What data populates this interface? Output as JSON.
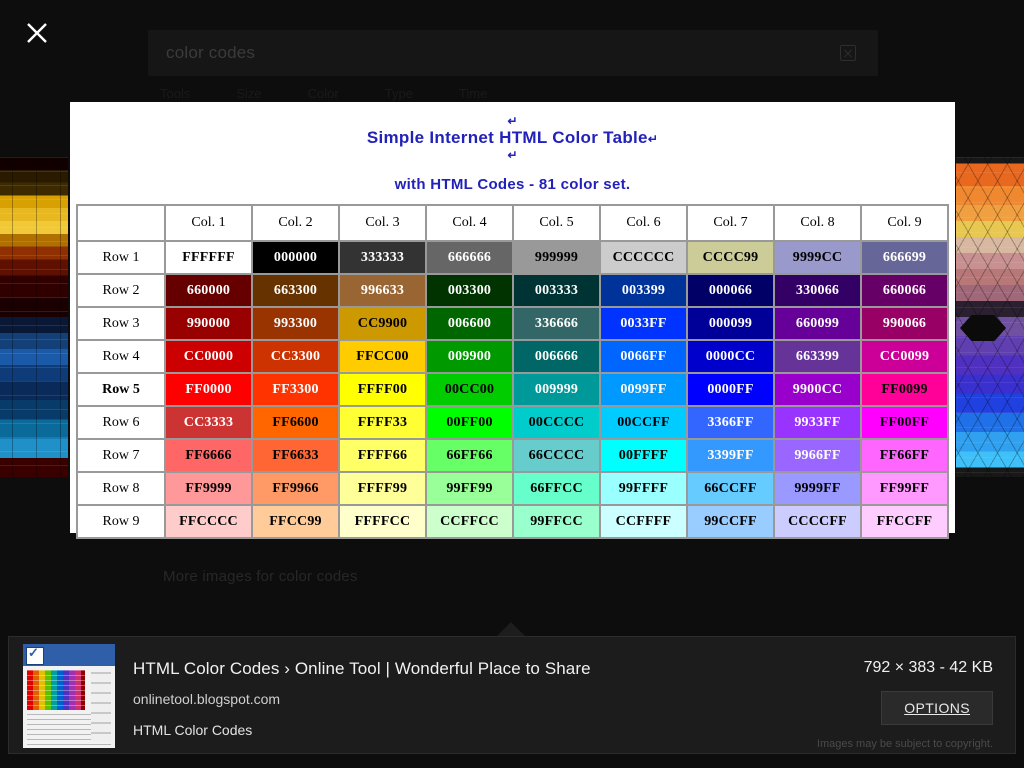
{
  "overlay": {
    "close_icon": "close-icon"
  },
  "search": {
    "query": "color codes",
    "clear_icon": "clear-icon",
    "filters": [
      "Tools",
      "Size",
      "Color",
      "Type",
      "Time"
    ]
  },
  "results": {
    "more_images_label": "More images for color codes"
  },
  "image": {
    "title_line1": "Simple Internet HTML Color Table",
    "title_line2": "with HTML Codes - 81 color set.",
    "pilcrow": "↵",
    "title_color": "#2222BB",
    "background": "#FFFFFF",
    "border_color": "#999999",
    "table": {
      "corner_label": "",
      "column_headers": [
        "Col. 1",
        "Col. 2",
        "Col. 3",
        "Col. 4",
        "Col. 5",
        "Col. 6",
        "Col. 7",
        "Col. 8",
        "Col. 9"
      ],
      "rows": [
        {
          "label": "Row 1",
          "bold_label": false,
          "cells": [
            {
              "hex": "FFFFFF",
              "bg": "#FFFFFF",
              "fg": "#000000"
            },
            {
              "hex": "000000",
              "bg": "#000000",
              "fg": "#FFFFFF"
            },
            {
              "hex": "333333",
              "bg": "#333333",
              "fg": "#FFFFFF"
            },
            {
              "hex": "666666",
              "bg": "#666666",
              "fg": "#FFFFFF"
            },
            {
              "hex": "999999",
              "bg": "#999999",
              "fg": "#000000"
            },
            {
              "hex": "CCCCCC",
              "bg": "#CCCCCC",
              "fg": "#000000"
            },
            {
              "hex": "CCCC99",
              "bg": "#CCCC99",
              "fg": "#000000"
            },
            {
              "hex": "9999CC",
              "bg": "#9999CC",
              "fg": "#000000"
            },
            {
              "hex": "666699",
              "bg": "#666699",
              "fg": "#FFFFFF"
            }
          ]
        },
        {
          "label": "Row 2",
          "bold_label": false,
          "cells": [
            {
              "hex": "660000",
              "bg": "#660000",
              "fg": "#FFFFFF"
            },
            {
              "hex": "663300",
              "bg": "#663300",
              "fg": "#FFFFFF"
            },
            {
              "hex": "996633",
              "bg": "#996633",
              "fg": "#FFFFFF"
            },
            {
              "hex": "003300",
              "bg": "#003300",
              "fg": "#FFFFFF"
            },
            {
              "hex": "003333",
              "bg": "#003333",
              "fg": "#FFFFFF"
            },
            {
              "hex": "003399",
              "bg": "#003399",
              "fg": "#FFFFFF"
            },
            {
              "hex": "000066",
              "bg": "#000066",
              "fg": "#FFFFFF"
            },
            {
              "hex": "330066",
              "bg": "#330066",
              "fg": "#FFFFFF"
            },
            {
              "hex": "660066",
              "bg": "#660066",
              "fg": "#FFFFFF"
            }
          ]
        },
        {
          "label": "Row 3",
          "bold_label": false,
          "cells": [
            {
              "hex": "990000",
              "bg": "#990000",
              "fg": "#FFFFFF"
            },
            {
              "hex": "993300",
              "bg": "#993300",
              "fg": "#FFFFFF"
            },
            {
              "hex": "CC9900",
              "bg": "#CC9900",
              "fg": "#000000"
            },
            {
              "hex": "006600",
              "bg": "#006600",
              "fg": "#FFFFFF"
            },
            {
              "hex": "336666",
              "bg": "#336666",
              "fg": "#FFFFFF"
            },
            {
              "hex": "0033FF",
              "bg": "#0033FF",
              "fg": "#FFFFFF"
            },
            {
              "hex": "000099",
              "bg": "#000099",
              "fg": "#FFFFFF"
            },
            {
              "hex": "660099",
              "bg": "#660099",
              "fg": "#FFFFFF"
            },
            {
              "hex": "990066",
              "bg": "#990066",
              "fg": "#FFFFFF"
            }
          ]
        },
        {
          "label": "Row 4",
          "bold_label": false,
          "cells": [
            {
              "hex": "CC0000",
              "bg": "#CC0000",
              "fg": "#FFFFFF"
            },
            {
              "hex": "CC3300",
              "bg": "#CC3300",
              "fg": "#FFFFFF"
            },
            {
              "hex": "FFCC00",
              "bg": "#FFCC00",
              "fg": "#000000"
            },
            {
              "hex": "009900",
              "bg": "#009900",
              "fg": "#FFFFFF"
            },
            {
              "hex": "006666",
              "bg": "#006666",
              "fg": "#FFFFFF"
            },
            {
              "hex": "0066FF",
              "bg": "#0066FF",
              "fg": "#FFFFFF"
            },
            {
              "hex": "0000CC",
              "bg": "#0000CC",
              "fg": "#FFFFFF"
            },
            {
              "hex": "663399",
              "bg": "#663399",
              "fg": "#FFFFFF"
            },
            {
              "hex": "CC0099",
              "bg": "#CC0099",
              "fg": "#FFFFFF"
            }
          ]
        },
        {
          "label": "Row 5",
          "bold_label": true,
          "cells": [
            {
              "hex": "FF0000",
              "bg": "#FF0000",
              "fg": "#FFFFFF"
            },
            {
              "hex": "FF3300",
              "bg": "#FF3300",
              "fg": "#FFFFFF"
            },
            {
              "hex": "FFFF00",
              "bg": "#FFFF00",
              "fg": "#000000"
            },
            {
              "hex": "00CC00",
              "bg": "#00CC00",
              "fg": "#000000"
            },
            {
              "hex": "009999",
              "bg": "#009999",
              "fg": "#FFFFFF"
            },
            {
              "hex": "0099FF",
              "bg": "#0099FF",
              "fg": "#FFFFFF"
            },
            {
              "hex": "0000FF",
              "bg": "#0000FF",
              "fg": "#FFFFFF"
            },
            {
              "hex": "9900CC",
              "bg": "#9900CC",
              "fg": "#FFFFFF"
            },
            {
              "hex": "FF0099",
              "bg": "#FF0099",
              "fg": "#000000"
            }
          ]
        },
        {
          "label": "Row 6",
          "bold_label": false,
          "cells": [
            {
              "hex": "CC3333",
              "bg": "#CC3333",
              "fg": "#FFFFFF"
            },
            {
              "hex": "FF6600",
              "bg": "#FF6600",
              "fg": "#000000"
            },
            {
              "hex": "FFFF33",
              "bg": "#FFFF33",
              "fg": "#000000"
            },
            {
              "hex": "00FF00",
              "bg": "#00FF00",
              "fg": "#000000"
            },
            {
              "hex": "00CCCC",
              "bg": "#00CCCC",
              "fg": "#000000"
            },
            {
              "hex": "00CCFF",
              "bg": "#00CCFF",
              "fg": "#000000"
            },
            {
              "hex": "3366FF",
              "bg": "#3366FF",
              "fg": "#FFFFFF"
            },
            {
              "hex": "9933FF",
              "bg": "#9933FF",
              "fg": "#FFFFFF"
            },
            {
              "hex": "FF00FF",
              "bg": "#FF00FF",
              "fg": "#000000"
            }
          ]
        },
        {
          "label": "Row 7",
          "bold_label": false,
          "cells": [
            {
              "hex": "FF6666",
              "bg": "#FF6666",
              "fg": "#000000"
            },
            {
              "hex": "FF6633",
              "bg": "#FF6633",
              "fg": "#000000"
            },
            {
              "hex": "FFFF66",
              "bg": "#FFFF66",
              "fg": "#000000"
            },
            {
              "hex": "66FF66",
              "bg": "#66FF66",
              "fg": "#000000"
            },
            {
              "hex": "66CCCC",
              "bg": "#66CCCC",
              "fg": "#000000"
            },
            {
              "hex": "00FFFF",
              "bg": "#00FFFF",
              "fg": "#000000"
            },
            {
              "hex": "3399FF",
              "bg": "#3399FF",
              "fg": "#FFFFFF"
            },
            {
              "hex": "9966FF",
              "bg": "#9966FF",
              "fg": "#FFFFFF"
            },
            {
              "hex": "FF66FF",
              "bg": "#FF66FF",
              "fg": "#000000"
            }
          ]
        },
        {
          "label": "Row 8",
          "bold_label": false,
          "cells": [
            {
              "hex": "FF9999",
              "bg": "#FF9999",
              "fg": "#000000"
            },
            {
              "hex": "FF9966",
              "bg": "#FF9966",
              "fg": "#000000"
            },
            {
              "hex": "FFFF99",
              "bg": "#FFFF99",
              "fg": "#000000"
            },
            {
              "hex": "99FF99",
              "bg": "#99FF99",
              "fg": "#000000"
            },
            {
              "hex": "66FFCC",
              "bg": "#66FFCC",
              "fg": "#000000"
            },
            {
              "hex": "99FFFF",
              "bg": "#99FFFF",
              "fg": "#000000"
            },
            {
              "hex": "66CCFF",
              "bg": "#66CCFF",
              "fg": "#000000"
            },
            {
              "hex": "9999FF",
              "bg": "#9999FF",
              "fg": "#000000"
            },
            {
              "hex": "FF99FF",
              "bg": "#FF99FF",
              "fg": "#000000"
            }
          ]
        },
        {
          "label": "Row 9",
          "bold_label": false,
          "cells": [
            {
              "hex": "FFCCCC",
              "bg": "#FFCCCC",
              "fg": "#000000"
            },
            {
              "hex": "FFCC99",
              "bg": "#FFCC99",
              "fg": "#000000"
            },
            {
              "hex": "FFFFCC",
              "bg": "#FFFFCC",
              "fg": "#000000"
            },
            {
              "hex": "CCFFCC",
              "bg": "#CCFFCC",
              "fg": "#000000"
            },
            {
              "hex": "99FFCC",
              "bg": "#99FFCC",
              "fg": "#000000"
            },
            {
              "hex": "CCFFFF",
              "bg": "#CCFFFF",
              "fg": "#000000"
            },
            {
              "hex": "99CCFF",
              "bg": "#99CCFF",
              "fg": "#000000"
            },
            {
              "hex": "CCCCFF",
              "bg": "#CCCCFF",
              "fg": "#000000"
            },
            {
              "hex": "FFCCFF",
              "bg": "#FFCCFF",
              "fg": "#000000"
            }
          ]
        }
      ]
    }
  },
  "info": {
    "title": "HTML Color Codes › Online Tool | Wonderful Place to Share",
    "domain": "onlinetool.blogspot.com",
    "caption": "HTML Color Codes",
    "dimensions": "792 × 383 - 42 KB",
    "options_label": "OPTIONS",
    "copyright": "Images may be subject to copyright."
  }
}
